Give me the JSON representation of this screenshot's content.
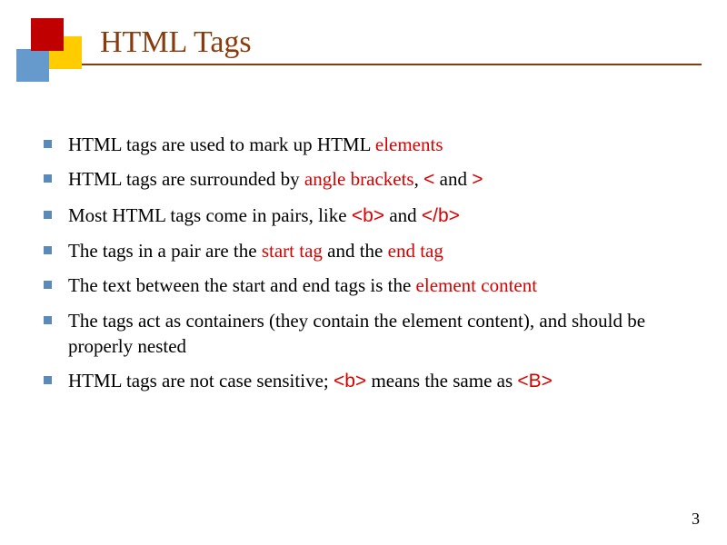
{
  "title": "HTML Tags",
  "page_number": "3",
  "bullets": {
    "b0": {
      "p0": "HTML tags are used to mark up HTML ",
      "p1": "elements"
    },
    "b1": {
      "p0": "HTML tags are surrounded by ",
      "p1": "angle brackets",
      "p2": ",  ",
      "p3": "<",
      "p4": "  and  ",
      "p5": ">"
    },
    "b2": {
      "p0": "Most HTML tags come in pairs, like ",
      "p1": "<b>",
      "p2": " and ",
      "p3": "</b>"
    },
    "b3": {
      "p0": "The tags in a pair are the ",
      "p1": "start tag",
      "p2": " and the ",
      "p3": "end tag"
    },
    "b4": {
      "p0": "The text between the start and end tags is the ",
      "p1": "element content"
    },
    "b5": {
      "p0": "The tags act as containers (they contain the element content), and should be properly nested"
    },
    "b6": {
      "p0": "HTML tags are not case sensitive; ",
      "p1": "<b>",
      "p2": " means the same as ",
      "p3": "<B>"
    }
  }
}
